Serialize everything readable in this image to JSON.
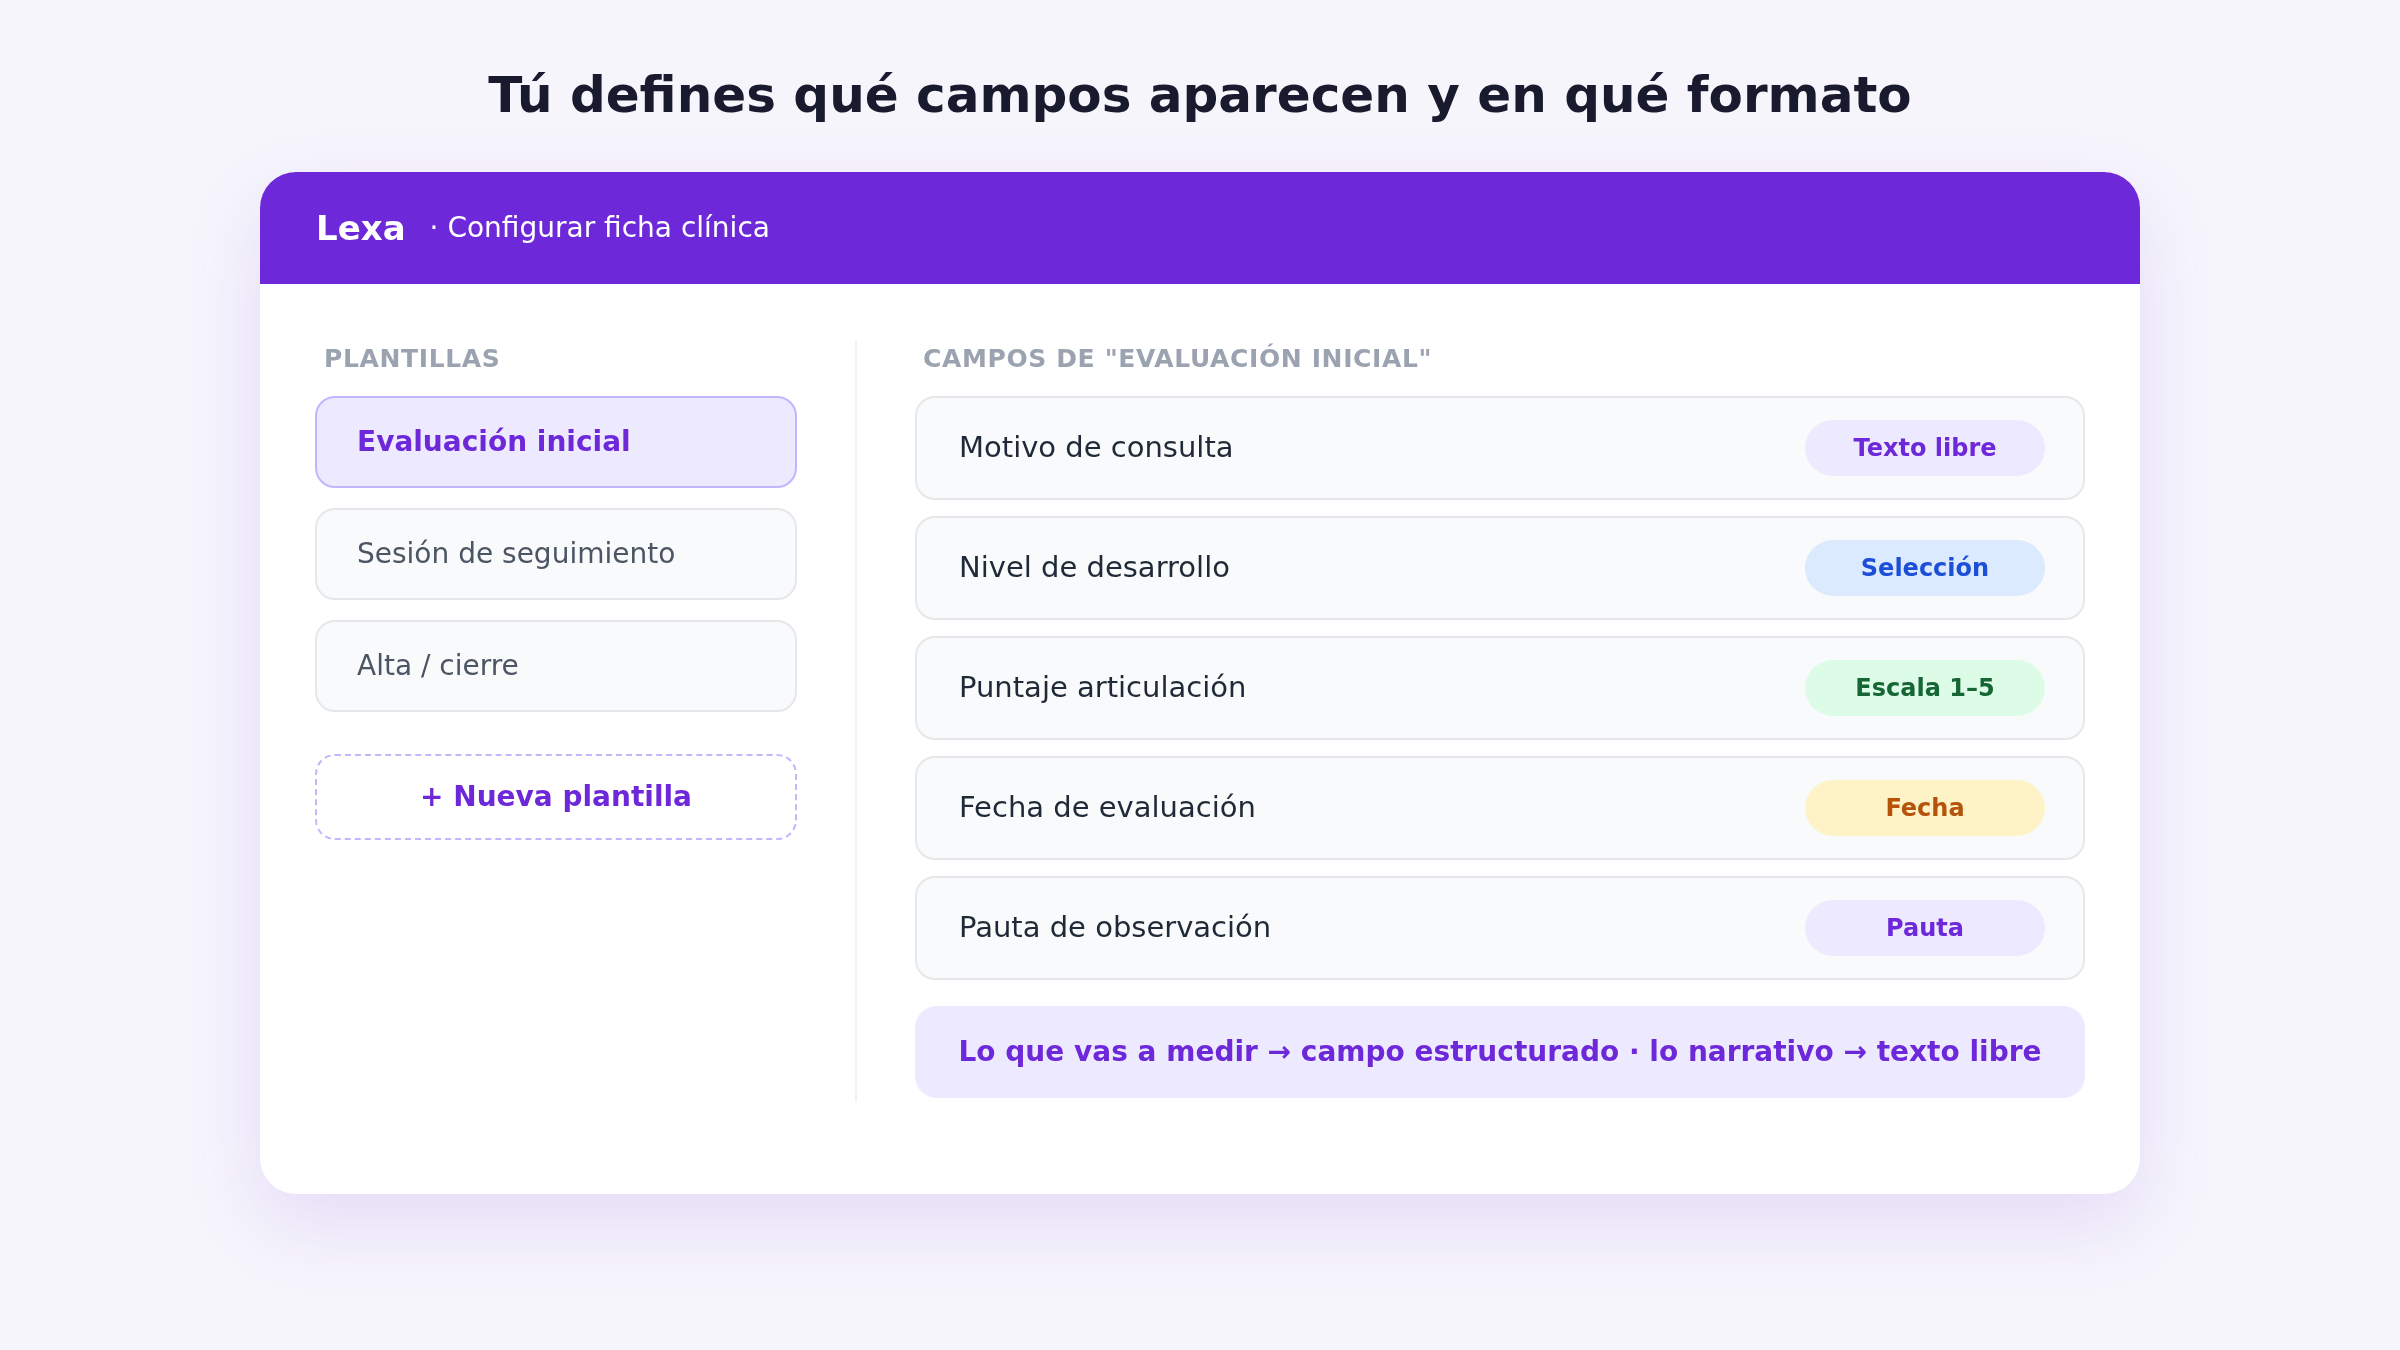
{
  "headline": "Tú defines qué campos aparecen y en qué formato",
  "header": {
    "brand": "Lexa",
    "subtitle": "· Configurar ficha clínica"
  },
  "templates": {
    "heading": "PLANTILLAS",
    "items": [
      {
        "label": "Evaluación inicial",
        "selected": true
      },
      {
        "label": "Sesión de seguimiento",
        "selected": false
      },
      {
        "label": "Alta / cierre",
        "selected": false
      }
    ],
    "new_button": "+ Nueva plantilla"
  },
  "fields": {
    "heading": "CAMPOS DE \"EVALUACIÓN INICIAL\"",
    "items": [
      {
        "label": "Motivo de consulta",
        "type": "Texto libre",
        "kind": "text"
      },
      {
        "label": "Nivel de desarrollo",
        "type": "Selección",
        "kind": "select"
      },
      {
        "label": "Puntaje articulación",
        "type": "Escala 1–5",
        "kind": "scale"
      },
      {
        "label": "Fecha de evaluación",
        "type": "Fecha",
        "kind": "date"
      },
      {
        "label": "Pauta de observación",
        "type": "Pauta",
        "kind": "checklist"
      }
    ],
    "tip": "Lo que vas a medir → campo estructurado · lo narrativo → texto libre"
  }
}
